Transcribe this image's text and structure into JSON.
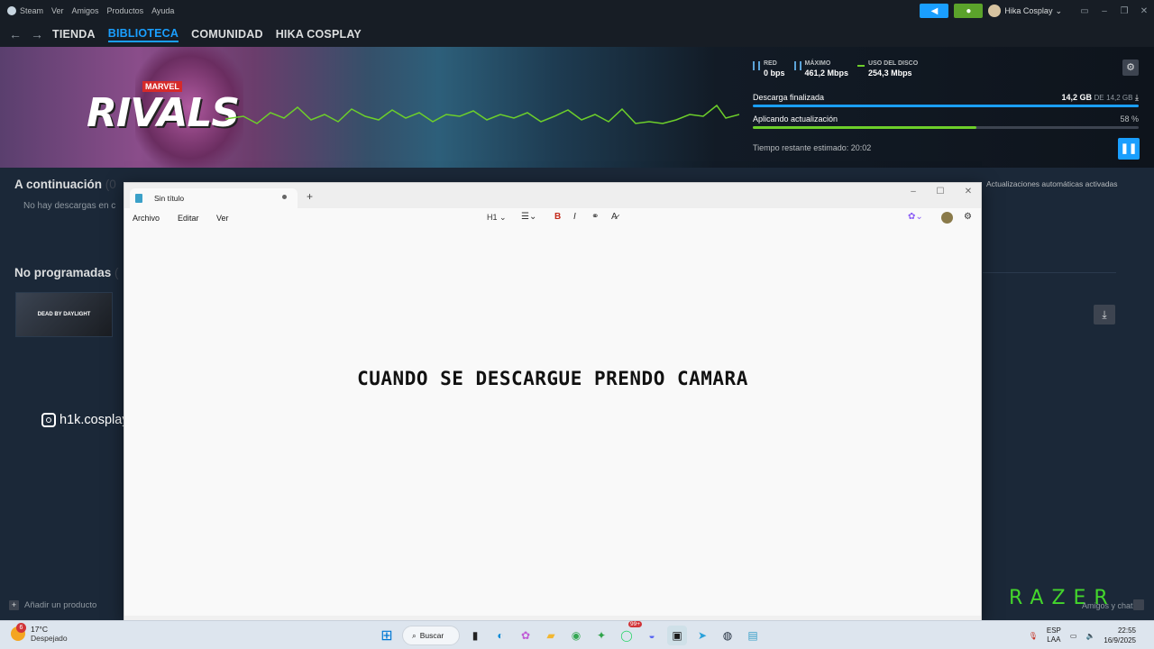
{
  "steam": {
    "menu": [
      "Steam",
      "Ver",
      "Amigos",
      "Productos",
      "Ayuda"
    ],
    "user": "Hika Cosplay",
    "nav": [
      "TIENDA",
      "BIBLIOTECA",
      "COMUNIDAD",
      "HIKA COSPLAY"
    ],
    "active_nav": "BIBLIOTECA"
  },
  "banner": {
    "logo_small": "MARVEL",
    "logo_main": "RIVALS",
    "stats": [
      {
        "label": "RED",
        "value": "0 bps"
      },
      {
        "label": "MÁXIMO",
        "value": "461,2 Mbps"
      },
      {
        "label": "USO DEL DISCO",
        "value": "254,3 Mbps"
      }
    ],
    "download_label": "Descarga finalizada",
    "download_done": "14,2 GB",
    "download_of": "DE",
    "download_total": "14,2 GB",
    "update_label": "Aplicando actualización",
    "update_percent_text": "58 %",
    "update_progress": 0.58,
    "eta": "Tiempo restante estimado: 20:02"
  },
  "library": {
    "continuation_title": "A continuación",
    "continuation_count": "(0",
    "no_downloads": "No hay descargas en c",
    "auto_updates": "Actualizaciones automáticas activadas",
    "unscheduled_title": "No programadas",
    "unscheduled_count": "(",
    "game_thumb": "DEAD BY DAYLIGHT",
    "add_product": "Añadir un producto",
    "friends_chat": "Amigos y chat",
    "razer": "RAZER"
  },
  "overlay": {
    "instagram": "h1k.cosplay"
  },
  "notepad": {
    "tab_title": "Sin título",
    "menu": [
      "Archivo",
      "Editar",
      "Ver"
    ],
    "heading_select": "H1",
    "body_text": "CUANDO SE DESCARGUE PRENDO CAMARA"
  },
  "taskbar": {
    "weather_badge": "6",
    "temperature": "17°C",
    "condition": "Despejado",
    "search_label": "Buscar",
    "whatsapp_badge": "99+",
    "lang_line1": "ESP",
    "lang_line2": "LAA",
    "time": "22:55",
    "date": "16/9/2025"
  },
  "colors": {
    "steam_bg": "#1b2838",
    "accent_blue": "#1a9fff",
    "progress_green": "#6dcf2a",
    "razer_green": "#44d62c"
  }
}
